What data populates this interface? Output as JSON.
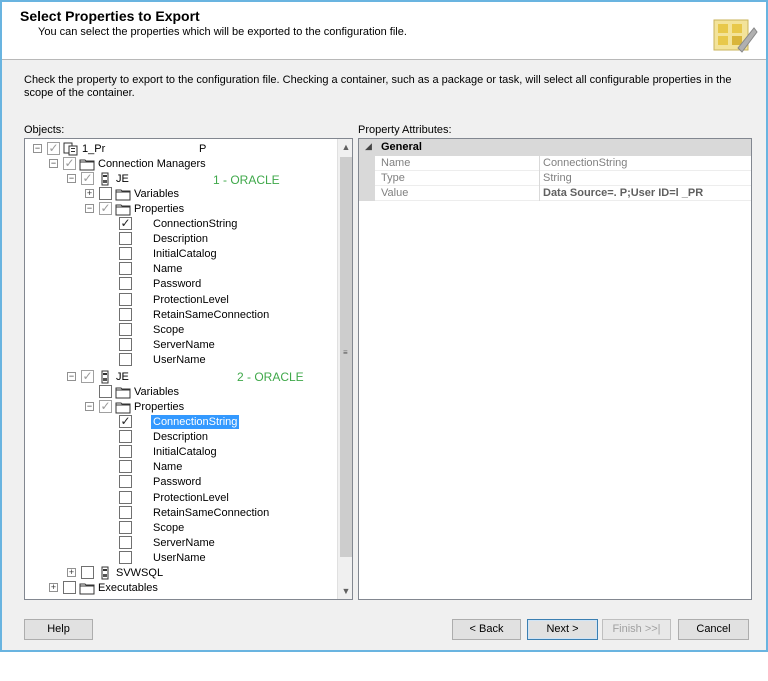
{
  "header": {
    "title": "Select Properties to Export",
    "subtitle": "You can select the properties which will be exported to the configuration file."
  },
  "instructions": "Check the property to export to the configuration file. Checking a container, such as a package or task, will select all configurable properties in the scope of the container.",
  "objects_label": "Objects:",
  "property_attributes_label": "Property Attributes:",
  "annotations": {
    "first": "1 - ORACLE",
    "second": "2 - ORACLE"
  },
  "tree": {
    "root": {
      "label": "1_Pr",
      "label_tail": "P"
    },
    "connection_managers": "Connection Managers",
    "conn1": {
      "label": "JE",
      "variables": "Variables",
      "properties": "Properties",
      "items": [
        "ConnectionString",
        "Description",
        "InitialCatalog",
        "Name",
        "Password",
        "ProtectionLevel",
        "RetainSameConnection",
        "Scope",
        "ServerName",
        "UserName"
      ]
    },
    "conn2": {
      "label": "JE",
      "variables": "Variables",
      "properties": "Properties",
      "items": [
        "ConnectionString",
        "Description",
        "InitialCatalog",
        "Name",
        "Password",
        "ProtectionLevel",
        "RetainSameConnection",
        "Scope",
        "ServerName",
        "UserName"
      ]
    },
    "svwsql": "SVWSQL",
    "executables": "Executables"
  },
  "property_grid": {
    "category": "General",
    "rows": [
      {
        "name": "Name",
        "value": "ConnectionString"
      },
      {
        "name": "Type",
        "value": "String"
      },
      {
        "name": "Value",
        "value": "Data Source=.     P;User ID=l     _PR"
      }
    ]
  },
  "buttons": {
    "help": "Help",
    "back": "< Back",
    "next": "Next >",
    "finish": "Finish >>|",
    "cancel": "Cancel"
  },
  "icons": {
    "expand": "plus-icon",
    "collapse": "minus-icon",
    "check": "checkmark-icon",
    "folder": "folder-icon",
    "connection": "connection-manager-icon",
    "package": "package-icon"
  }
}
